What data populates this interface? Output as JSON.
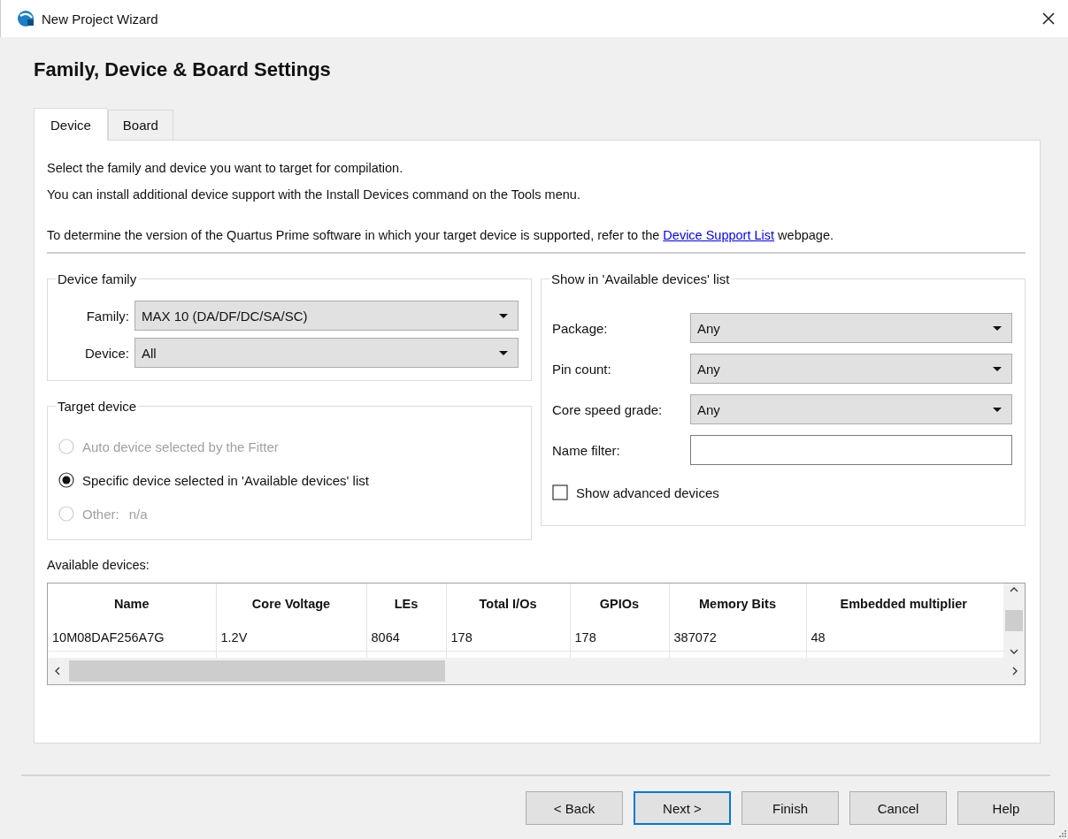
{
  "window": {
    "title": "New Project Wizard"
  },
  "heading": "Family, Device & Board Settings",
  "tabs": [
    {
      "label": "Device",
      "selected": true
    },
    {
      "label": "Board",
      "selected": false
    }
  ],
  "intro": [
    "Select the family and device you want to target for compilation.",
    "You can install additional device support with the Install Devices command on the Tools menu."
  ],
  "support_note": {
    "text_before": "To determine the version of the Quartus Prime software in which your target device is supported, refer to the ",
    "link": "Device Support List",
    "text_after": " webpage."
  },
  "device_family": {
    "title": "Device family",
    "fields": [
      {
        "label": "Family:",
        "value": "MAX 10 (DA/DF/DC/SA/SC)"
      },
      {
        "label": "Device:",
        "value": "All"
      }
    ]
  },
  "target_device": {
    "title": "Target device",
    "options": [
      {
        "label": "Auto device selected by the Fitter",
        "selected": false,
        "disabled": true
      },
      {
        "label": "Specific device selected in 'Available devices' list",
        "selected": true,
        "disabled": false
      },
      {
        "label": "Other:",
        "detail": "n/a",
        "selected": false,
        "disabled": true
      }
    ]
  },
  "filters": {
    "title": "Show in 'Available devices' list",
    "fields": [
      {
        "kind": "combo",
        "label": "Package:",
        "value": "Any"
      },
      {
        "kind": "combo",
        "label": "Pin count:",
        "value": "Any"
      },
      {
        "kind": "combo",
        "label": "Core speed grade:",
        "value": "Any"
      },
      {
        "kind": "text",
        "label": "Name filter:"
      }
    ],
    "checkbox": {
      "label": "Show advanced devices",
      "checked": false
    }
  },
  "available_devices": {
    "label": "Available devices:",
    "columns": [
      "Name",
      "Core Voltage",
      "LEs",
      "Total I/Os",
      "GPIOs",
      "Memory Bits",
      "Embedded multiplier"
    ],
    "rows": [
      [
        "10M08DAF256A7G",
        "1.2V",
        "8064",
        "178",
        "178",
        "387072",
        "48"
      ]
    ]
  },
  "buttons": [
    {
      "label": "< Back",
      "default": false
    },
    {
      "label": "Next >",
      "default": true
    },
    {
      "label": "Finish",
      "default": false
    },
    {
      "label": "Cancel",
      "default": false
    },
    {
      "label": "Help",
      "default": false
    }
  ]
}
